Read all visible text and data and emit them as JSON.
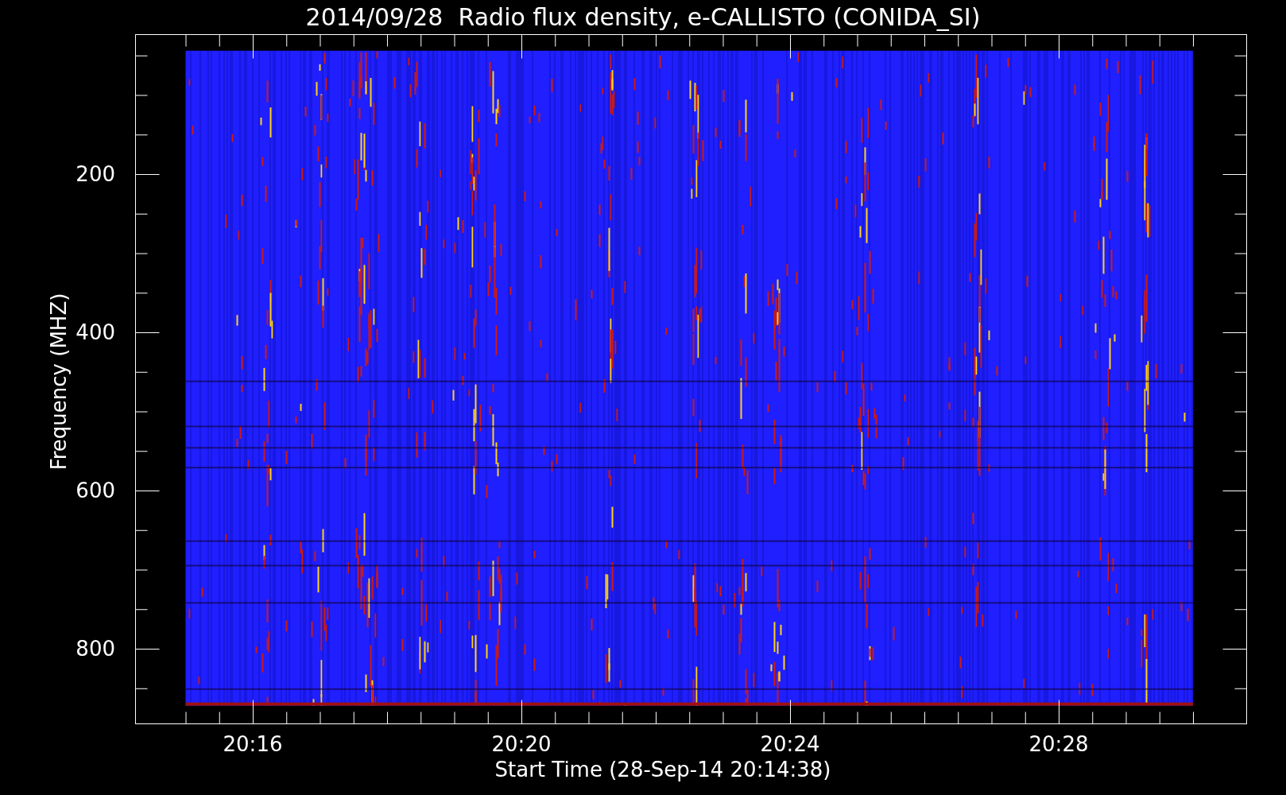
{
  "title": "2014/09/28  Radio flux density, e-CALLISTO (CONIDA_SI)",
  "y_axis": {
    "label": "Frequency (MHZ)",
    "ticks": [
      "200",
      "400",
      "600",
      "800"
    ]
  },
  "x_axis": {
    "label": "Start Time (28-Sep-14 20:14:38)",
    "ticks": [
      "20:16",
      "20:20",
      "20:24",
      "20:28"
    ]
  }
}
